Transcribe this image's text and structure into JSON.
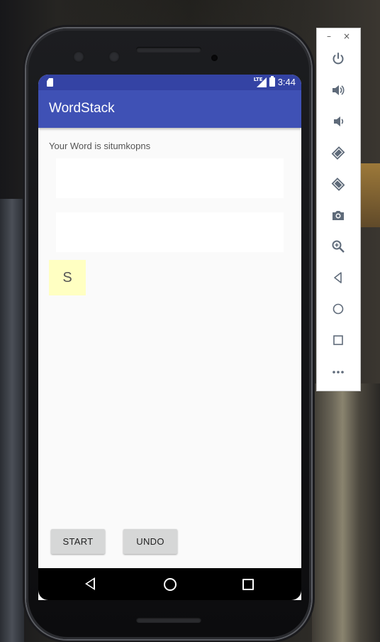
{
  "app": {
    "title": "WordStack",
    "word_label": "Your Word is situmkopns",
    "tile_letter": "S",
    "start_label": "START",
    "undo_label": "UNDO"
  },
  "statusbar": {
    "time": "3:44",
    "network": "LTE"
  },
  "colors": {
    "primary": "#3f51b5",
    "primary_dark": "#3443a4",
    "tile": "#ffffc2",
    "background": "#fafafa"
  },
  "emulator_toolbar": {
    "window_controls": [
      "–",
      "×"
    ],
    "buttons": [
      "power-icon",
      "volume-up-icon",
      "volume-down-icon",
      "rotate-left-icon",
      "rotate-right-icon",
      "camera-icon",
      "zoom-icon",
      "back-icon",
      "home-icon",
      "overview-icon",
      "more-icon"
    ]
  }
}
